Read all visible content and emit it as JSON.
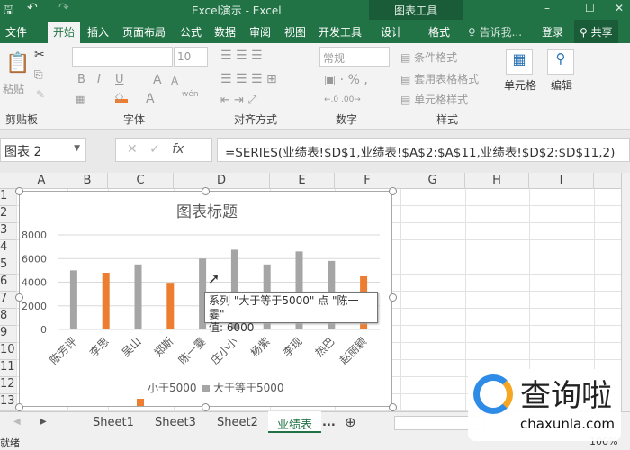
{
  "titlebar": {
    "title": "Excel演示 - Excel",
    "context_tab": "图表工具"
  },
  "menu": {
    "items": [
      "文件",
      "开始",
      "插入",
      "页面布局",
      "公式",
      "数据",
      "审阅",
      "视图",
      "开发工具",
      "设计",
      "格式"
    ],
    "tell_me": "告诉我...",
    "login": "登录",
    "share": "共享"
  },
  "ribbon": {
    "paste": "粘贴",
    "font_size": "10",
    "number_format": "常规",
    "cond_format": "条件格式",
    "table_format": "套用表格格式",
    "cell_style": "单元格样式",
    "cells": "单元格",
    "edit": "编辑",
    "groups": [
      "剪贴板",
      "字体",
      "对齐方式",
      "数字",
      "样式"
    ]
  },
  "formula_bar": {
    "name_box": "图表 2",
    "fx": "fx",
    "formula": "=SERIES(业绩表!$D$1,业绩表!$A$2:$A$11,业绩表!$D$2:$D$11,2)"
  },
  "columns": [
    "A",
    "B",
    "C",
    "D",
    "E",
    "F",
    "G",
    "H",
    "I"
  ],
  "rows": [
    "1",
    "2",
    "3",
    "4",
    "5",
    "6",
    "7",
    "8",
    "9",
    "10",
    "11",
    "12",
    "13"
  ],
  "chart_data": {
    "type": "bar",
    "title": "图表标题",
    "categories": [
      "陈芳评",
      "李思",
      "吴山",
      "郑斯",
      "陈一霎",
      "庄小小",
      "杨紫",
      "李现",
      "热巴",
      "赵丽颖"
    ],
    "series": [
      {
        "name": "小于5000",
        "color": "#ed7d31",
        "values": [
          null,
          4800,
          null,
          3950,
          null,
          null,
          null,
          null,
          null,
          4500
        ]
      },
      {
        "name": "大于等于5000",
        "color": "#a5a5a5",
        "values": [
          5000,
          null,
          5500,
          null,
          6000,
          6750,
          5500,
          6600,
          5800,
          null
        ]
      }
    ],
    "ylim": [
      0,
      8000
    ],
    "yticks": [
      "0",
      "2000",
      "4000",
      "6000",
      "8000"
    ],
    "grid": true,
    "legend": "bottom"
  },
  "tooltip": {
    "line1": "系列 \"大于等于5000\" 点 \"陈一霎\"",
    "line2": "值: 6000"
  },
  "sheets": {
    "tabs": [
      "Sheet1",
      "Sheet3",
      "Sheet2",
      "业绩表"
    ],
    "more": "...",
    "active": "业绩表"
  },
  "status": {
    "ready": "就绪",
    "zoom": "100%"
  },
  "watermark": {
    "text": "查询啦",
    "url": "chaxunla.com"
  }
}
